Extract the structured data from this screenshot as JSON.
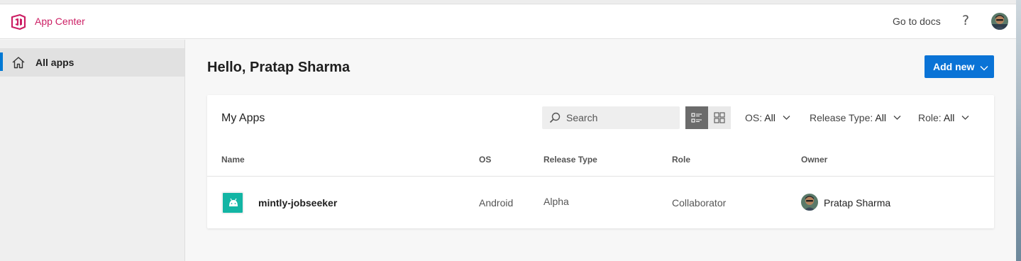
{
  "header": {
    "app_title": "App Center",
    "docs_link": "Go to docs",
    "help_label": "?"
  },
  "sidebar": {
    "items": [
      {
        "label": "All apps",
        "icon": "home-icon",
        "selected": true
      }
    ]
  },
  "main": {
    "greeting": "Hello, Pratap Sharma",
    "add_button": "Add new"
  },
  "apps_card": {
    "title": "My Apps",
    "search_placeholder": "Search",
    "view_mode": "list",
    "filters": {
      "os": {
        "label": "OS:",
        "value": "All"
      },
      "release_type": {
        "label": "Release Type:",
        "value": "All"
      },
      "role": {
        "label": "Role:",
        "value": "All"
      }
    },
    "columns": [
      "Name",
      "OS",
      "Release Type",
      "Role",
      "Owner"
    ],
    "rows": [
      {
        "name": "mintly-jobseeker",
        "os": "Android",
        "release_type": "Alpha",
        "role": "Collaborator",
        "owner": "Pratap Sharma",
        "icon": "android-icon"
      }
    ]
  },
  "colors": {
    "brand": "#cc1f64",
    "accent": "#0a73d6",
    "app_icon_bg": "#13b5a4"
  }
}
